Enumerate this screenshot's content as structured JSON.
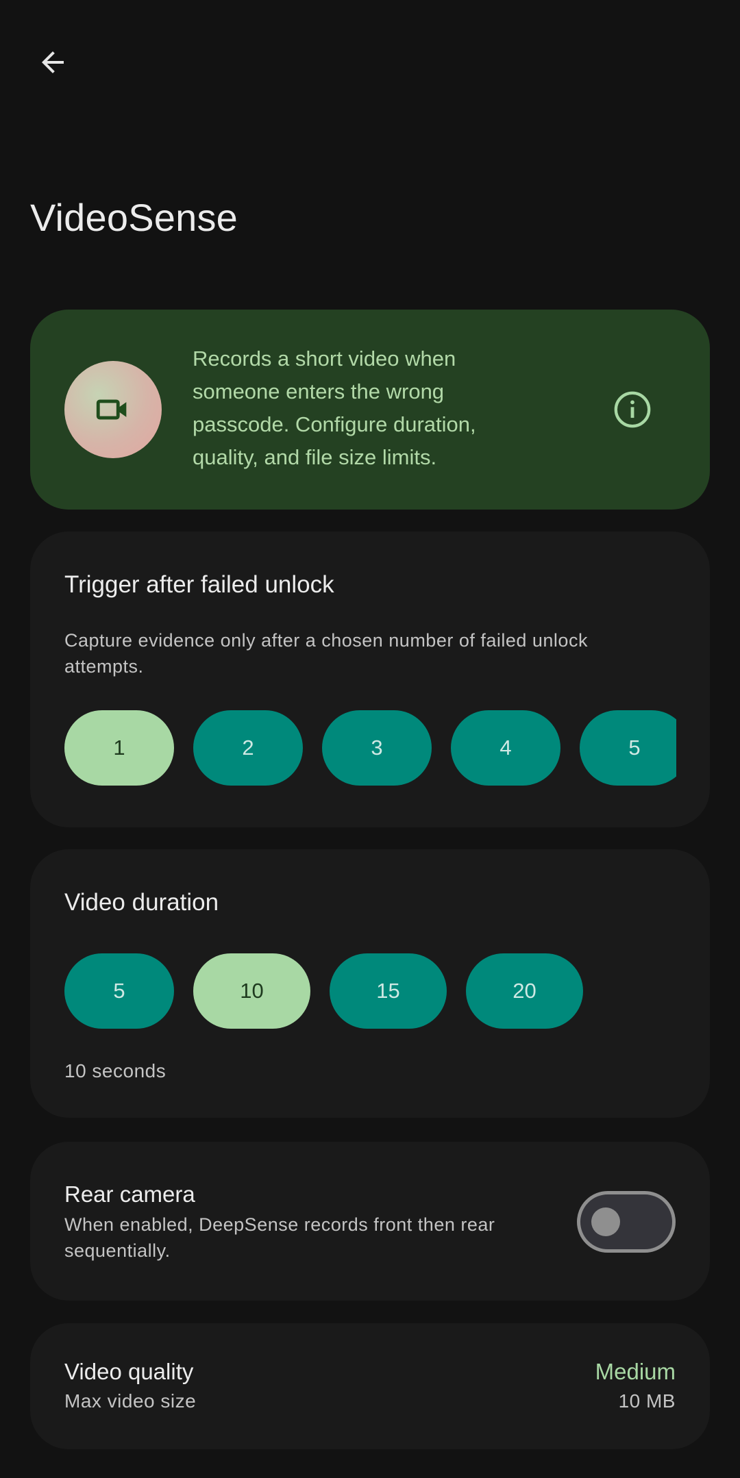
{
  "app": {
    "title": "VideoSense",
    "back_icon": "arrow-back-icon"
  },
  "banner": {
    "text": "Records a short video when someone enters the wrong passcode. Configure duration, quality, and file size limits.",
    "icon": "videocam-icon",
    "info_icon": "info-icon",
    "accent": "#244122"
  },
  "trigger": {
    "title": "Trigger after failed unlock",
    "description": "Capture evidence only after a chosen number of failed unlock attempts.",
    "options": [
      "1",
      "2",
      "3",
      "4",
      "5"
    ],
    "selected": "1"
  },
  "duration": {
    "title": "Video duration",
    "options": [
      "5",
      "10",
      "15",
      "20"
    ],
    "selected": "10",
    "helper": "10 seconds"
  },
  "rear_camera": {
    "title": "Rear camera",
    "description": "When enabled, DeepSense records front then rear sequentially.",
    "enabled": false
  },
  "quality": {
    "title": "Video quality",
    "subtitle": "Max video size",
    "value": "Medium",
    "size": "10 MB"
  },
  "colors": {
    "chip": "#00897b",
    "chip_selected": "#a8d8a4",
    "background": "#121212",
    "card": "#1a1a1a"
  }
}
